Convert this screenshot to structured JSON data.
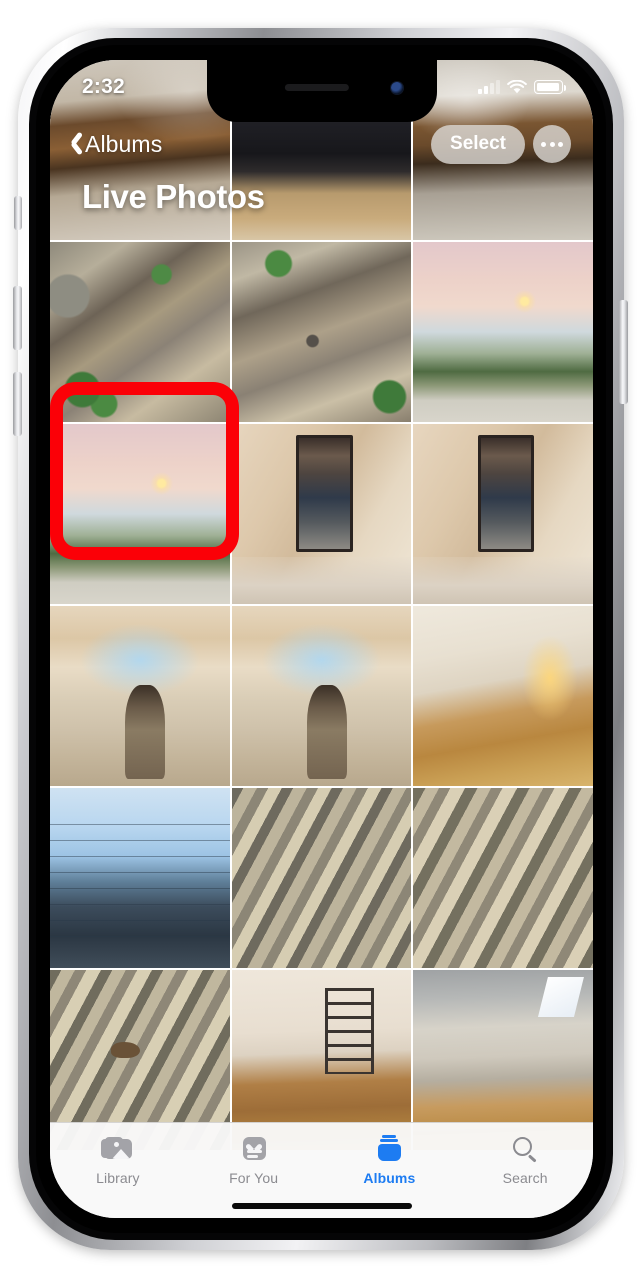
{
  "device": {
    "name": "iPhone",
    "buttons": {
      "silent_switch": "silent-switch",
      "volume_up": "volume-up-button",
      "volume_down": "volume-down-button",
      "power": "power-button"
    }
  },
  "status_bar": {
    "time": "2:32",
    "cellular_icon": "cellular-bars-icon",
    "cellular_bars_filled": 2,
    "cellular_bars_total": 4,
    "wifi_icon": "wifi-icon",
    "battery_icon": "battery-icon",
    "battery_level_percent": 95
  },
  "nav_bar": {
    "back_chevron_icon": "chevron-left-icon",
    "back_label": "Albums",
    "select_label": "Select",
    "more_icon": "ellipsis-icon"
  },
  "page_title": "Live Photos",
  "annotation": {
    "type": "red-highlight-box",
    "color": "#fb0007",
    "targets_cell_index": 6,
    "target_description": "sunset-road-photo"
  },
  "grid": {
    "columns": 3,
    "rows": 6,
    "photos": [
      {
        "index": 0,
        "name": "kitchen-bench-photo",
        "art": "ph-kitchen-bench"
      },
      {
        "index": 1,
        "name": "people-standing-photo",
        "art": "ph-people-legs"
      },
      {
        "index": 2,
        "name": "kitchen-table-photo",
        "art": "ph-kitchen-table"
      },
      {
        "index": 3,
        "name": "leaves-snake-photo-a",
        "art": "ph-leaves-snake-a"
      },
      {
        "index": 4,
        "name": "leaves-snake-photo-b",
        "art": "ph-leaves-snake-b"
      },
      {
        "index": 5,
        "name": "sunset-road-photo-a",
        "art": "ph-sunset-road"
      },
      {
        "index": 6,
        "name": "sunset-road-photo-b",
        "art": "ph-sunset-road"
      },
      {
        "index": 7,
        "name": "mirror-selfie-photo-a",
        "art": "ph-mirror-person"
      },
      {
        "index": 8,
        "name": "mirror-selfie-photo-b",
        "art": "ph-mirror-person"
      },
      {
        "index": 9,
        "name": "attic-room-wave-photo-a",
        "art": "ph-room-wave"
      },
      {
        "index": 10,
        "name": "attic-room-wave-photo-b",
        "art": "ph-room-wave"
      },
      {
        "index": 11,
        "name": "hallway-lamp-photo",
        "art": "ph-hallway-lamp"
      },
      {
        "index": 12,
        "name": "window-reflection-photo",
        "art": "ph-window-reflect"
      },
      {
        "index": 13,
        "name": "deck-boards-photo-a",
        "art": "ph-deck-boards-a"
      },
      {
        "index": 14,
        "name": "deck-boards-photo-b",
        "art": "ph-deck-boards-b"
      },
      {
        "index": 15,
        "name": "deck-chipmunk-photo",
        "art": "ph-deck-chipmunk"
      },
      {
        "index": 16,
        "name": "living-room-shelf-photo",
        "art": "ph-living-shelf"
      },
      {
        "index": 17,
        "name": "attic-kitchen-photo",
        "art": "ph-kitchen-attic"
      }
    ]
  },
  "tab_bar": {
    "accent_color": "#1d7cf2",
    "inactive_color": "#8b8b90",
    "tabs": [
      {
        "id": "library",
        "label": "Library",
        "icon": "photo-stack-icon",
        "active": false
      },
      {
        "id": "foryou",
        "label": "For You",
        "icon": "heart-card-icon",
        "active": false
      },
      {
        "id": "albums",
        "label": "Albums",
        "icon": "albums-stack-icon",
        "active": true
      },
      {
        "id": "search",
        "label": "Search",
        "icon": "magnifier-icon",
        "active": false
      }
    ]
  }
}
